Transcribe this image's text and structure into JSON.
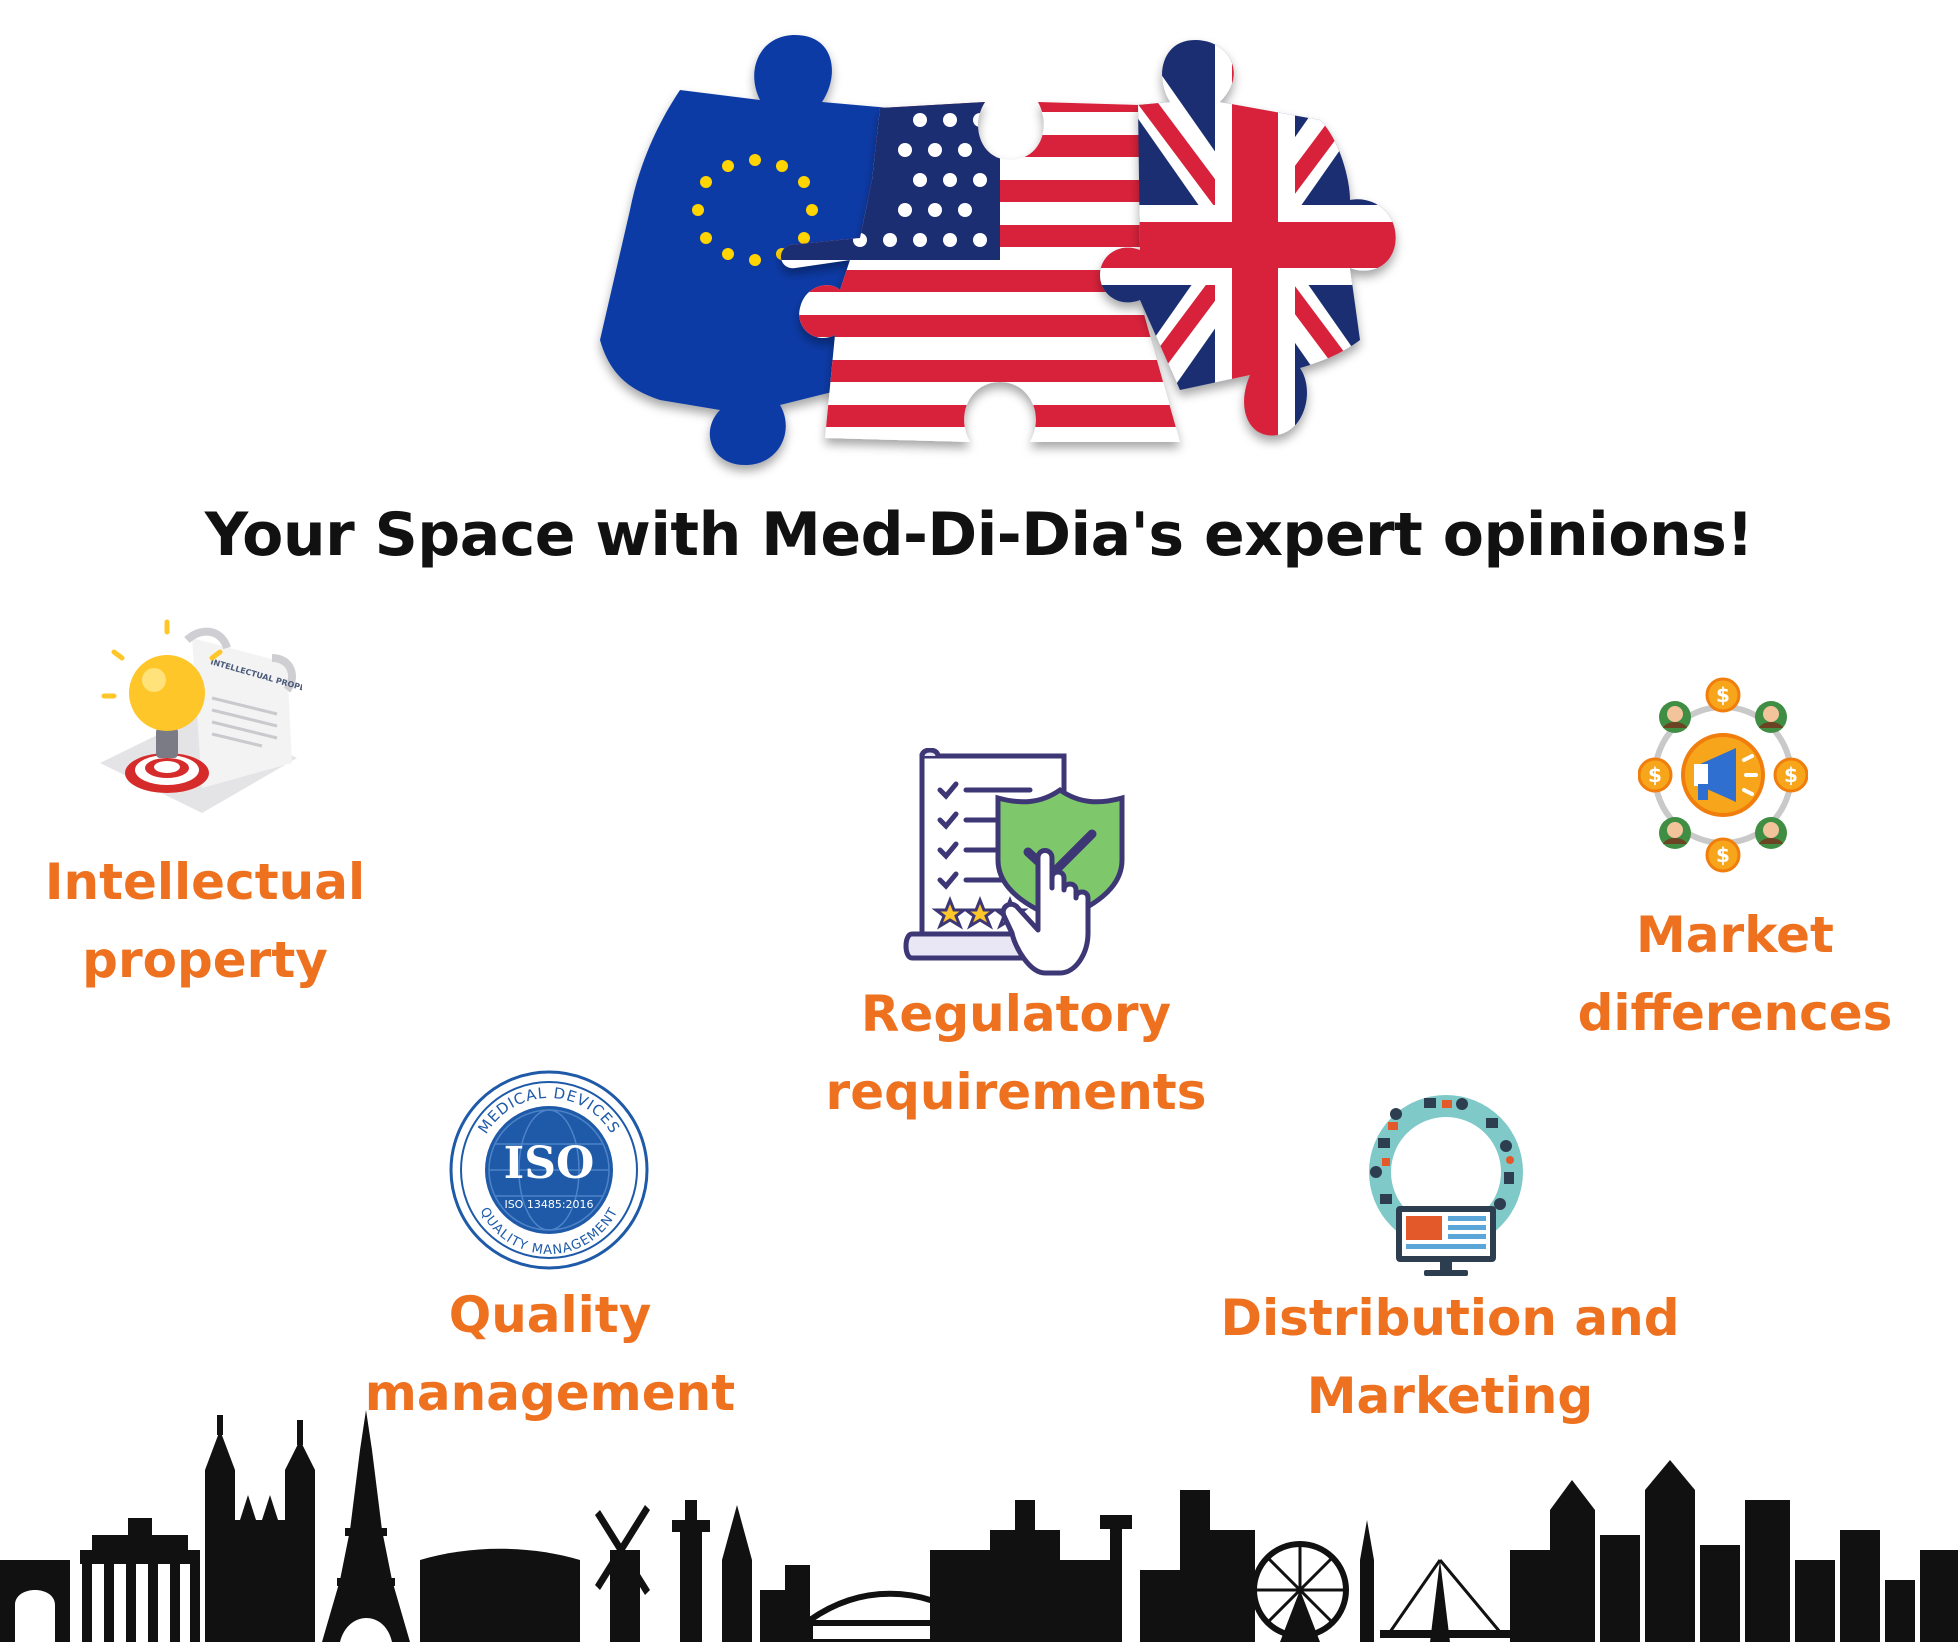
{
  "headline": "Your Space with Med-Di-Dia's expert opinions!",
  "colors": {
    "accent": "#ee7120",
    "headline": "#111111",
    "skyline": "#111111"
  },
  "puzzle": {
    "pieces": [
      "eu-flag-piece",
      "us-flag-piece",
      "uk-flag-piece"
    ]
  },
  "iso_badge": {
    "ring_top": "MEDICAL DEVICES",
    "center": "ISO",
    "standard": "ISO 13485:2016",
    "ring_bottom": "QUALITY MANAGEMENT"
  },
  "ip_doc": {
    "title": "INTELLECTUAL PROPERTY"
  },
  "market_icon": {
    "coin_symbol": "$"
  },
  "topics": [
    {
      "key": "ip",
      "icon": "lightbulb-copyright-icon",
      "line1": "Intellectual",
      "line2": "property"
    },
    {
      "key": "regulatory",
      "icon": "checklist-shield-icon",
      "line1": "Regulatory",
      "line2": "requirements"
    },
    {
      "key": "market",
      "icon": "megaphone-network-icon",
      "line1": "Market",
      "line2": "differences"
    },
    {
      "key": "quality",
      "icon": "iso-badge-icon",
      "line1": "Quality",
      "line2": "management"
    },
    {
      "key": "distribution",
      "icon": "marketing-monitor-icon",
      "line1": "Distribution and",
      "line2": "Marketing"
    }
  ]
}
